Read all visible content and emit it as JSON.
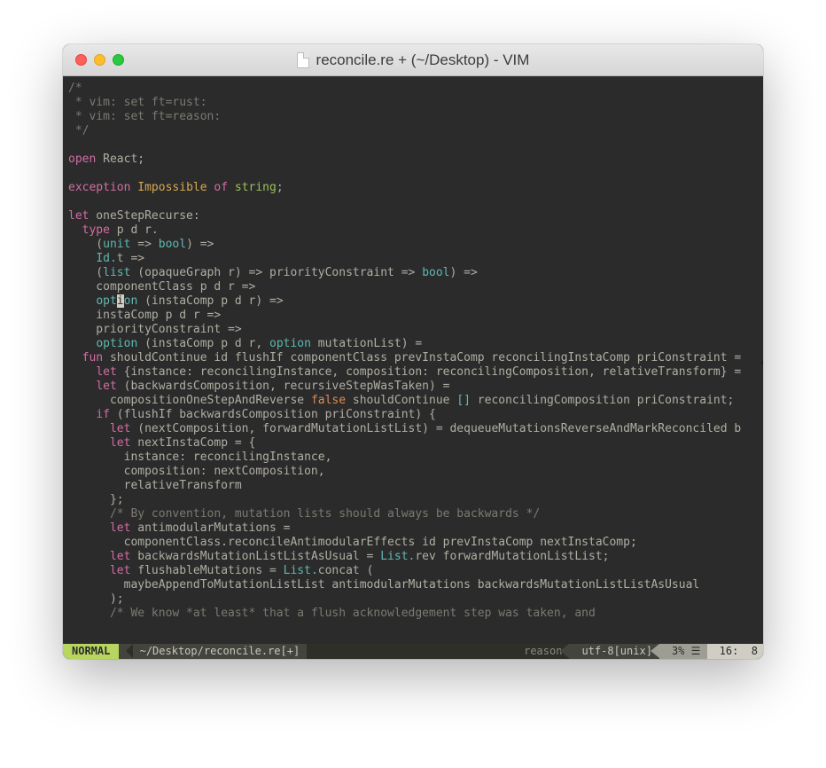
{
  "window": {
    "title": "reconcile.re + (~/Desktop) - VIM"
  },
  "code": {
    "lines": [
      [
        {
          "cls": "c-gray",
          "t": "/*"
        }
      ],
      [
        {
          "cls": "c-gray",
          "t": " * vim: set ft=rust:"
        }
      ],
      [
        {
          "cls": "c-gray",
          "t": " * vim: set ft=reason:"
        }
      ],
      [
        {
          "cls": "c-gray",
          "t": " */"
        }
      ],
      [
        {
          "cls": "",
          "t": ""
        }
      ],
      [
        {
          "cls": "c-mag",
          "t": "open"
        },
        {
          "cls": "",
          "t": " React;"
        }
      ],
      [
        {
          "cls": "",
          "t": ""
        }
      ],
      [
        {
          "cls": "c-mag",
          "t": "exception"
        },
        {
          "cls": "",
          "t": " "
        },
        {
          "cls": "c-gold",
          "t": "Impossible"
        },
        {
          "cls": "",
          "t": " "
        },
        {
          "cls": "c-mag",
          "t": "of"
        },
        {
          "cls": "",
          "t": " "
        },
        {
          "cls": "c-green",
          "t": "string"
        },
        {
          "cls": "",
          "t": ";"
        }
      ],
      [
        {
          "cls": "",
          "t": ""
        }
      ],
      [
        {
          "cls": "c-mag",
          "t": "let"
        },
        {
          "cls": "",
          "t": " oneStepRecurse:"
        }
      ],
      [
        {
          "cls": "",
          "t": "  "
        },
        {
          "cls": "c-mag",
          "t": "type"
        },
        {
          "cls": "",
          "t": " p d r."
        }
      ],
      [
        {
          "cls": "",
          "t": "    ("
        },
        {
          "cls": "c-teal",
          "t": "unit"
        },
        {
          "cls": "",
          "t": " => "
        },
        {
          "cls": "c-teal",
          "t": "bool"
        },
        {
          "cls": "",
          "t": ") =>"
        }
      ],
      [
        {
          "cls": "",
          "t": "    "
        },
        {
          "cls": "c-teal",
          "t": "Id."
        },
        {
          "cls": "",
          "t": "t =>"
        }
      ],
      [
        {
          "cls": "",
          "t": "    ("
        },
        {
          "cls": "c-teal",
          "t": "list"
        },
        {
          "cls": "",
          "t": " (opaqueGraph r) => priorityConstraint => "
        },
        {
          "cls": "c-teal",
          "t": "bool"
        },
        {
          "cls": "",
          "t": ") =>"
        }
      ],
      [
        {
          "cls": "",
          "t": "    componentClass p d r =>"
        }
      ],
      [
        {
          "cls": "",
          "t": "    "
        },
        {
          "cls": "c-teal",
          "t": "opt"
        },
        {
          "cls": "cursor",
          "t": "i"
        },
        {
          "cls": "c-teal",
          "t": "on"
        },
        {
          "cls": "",
          "t": " (instaComp p d r) =>"
        }
      ],
      [
        {
          "cls": "",
          "t": "    instaComp p d r =>"
        }
      ],
      [
        {
          "cls": "",
          "t": "    priorityConstraint =>"
        }
      ],
      [
        {
          "cls": "",
          "t": "    "
        },
        {
          "cls": "c-teal",
          "t": "option"
        },
        {
          "cls": "",
          "t": " (instaComp p d r, "
        },
        {
          "cls": "c-teal",
          "t": "option"
        },
        {
          "cls": "",
          "t": " mutationList) ="
        }
      ],
      [
        {
          "cls": "",
          "t": "  "
        },
        {
          "cls": "c-mag",
          "t": "fun"
        },
        {
          "cls": "",
          "t": " shouldContinue id flushIf componentClass prevInstaComp reconcilingInstaComp priConstraint ="
        }
      ],
      [
        {
          "cls": "",
          "t": "    "
        },
        {
          "cls": "c-mag",
          "t": "let"
        },
        {
          "cls": "",
          "t": " {instance: reconcilingInstance, composition: reconcilingComposition, relativeTransform} ="
        }
      ],
      [
        {
          "cls": "",
          "t": "    "
        },
        {
          "cls": "c-mag",
          "t": "let"
        },
        {
          "cls": "",
          "t": " (backwardsComposition, recursiveStepWasTaken) ="
        }
      ],
      [
        {
          "cls": "",
          "t": "      compositionOneStepAndReverse "
        },
        {
          "cls": "c-orange",
          "t": "false"
        },
        {
          "cls": "",
          "t": " shouldContinue "
        },
        {
          "cls": "c-teal",
          "t": "[]"
        },
        {
          "cls": "",
          "t": " reconcilingComposition priConstraint;"
        }
      ],
      [
        {
          "cls": "",
          "t": "    "
        },
        {
          "cls": "c-mag",
          "t": "if"
        },
        {
          "cls": "",
          "t": " (flushIf backwardsComposition priConstraint) {"
        }
      ],
      [
        {
          "cls": "",
          "t": "      "
        },
        {
          "cls": "c-mag",
          "t": "let"
        },
        {
          "cls": "",
          "t": " (nextComposition, forwardMutationListList) = dequeueMutationsReverseAndMarkReconciled b"
        }
      ],
      [
        {
          "cls": "",
          "t": "      "
        },
        {
          "cls": "c-mag",
          "t": "let"
        },
        {
          "cls": "",
          "t": " nextInstaComp = {"
        }
      ],
      [
        {
          "cls": "",
          "t": "        instance: reconcilingInstance,"
        }
      ],
      [
        {
          "cls": "",
          "t": "        composition: nextComposition,"
        }
      ],
      [
        {
          "cls": "",
          "t": "        relativeTransform"
        }
      ],
      [
        {
          "cls": "",
          "t": "      };"
        }
      ],
      [
        {
          "cls": "",
          "t": "      "
        },
        {
          "cls": "c-gray",
          "t": "/* By convention, mutation lists should always be backwards */"
        }
      ],
      [
        {
          "cls": "",
          "t": "      "
        },
        {
          "cls": "c-mag",
          "t": "let"
        },
        {
          "cls": "",
          "t": " antimodularMutations ="
        }
      ],
      [
        {
          "cls": "",
          "t": "        componentClass.reconcileAntimodularEffects id prevInstaComp nextInstaComp;"
        }
      ],
      [
        {
          "cls": "",
          "t": "      "
        },
        {
          "cls": "c-mag",
          "t": "let"
        },
        {
          "cls": "",
          "t": " backwardsMutationListListAsUsual = "
        },
        {
          "cls": "c-teal",
          "t": "List."
        },
        {
          "cls": "",
          "t": "rev forwardMutationListList;"
        }
      ],
      [
        {
          "cls": "",
          "t": "      "
        },
        {
          "cls": "c-mag",
          "t": "let"
        },
        {
          "cls": "",
          "t": " flushableMutations = "
        },
        {
          "cls": "c-teal",
          "t": "List."
        },
        {
          "cls": "",
          "t": "concat ("
        }
      ],
      [
        {
          "cls": "",
          "t": "        maybeAppendToMutationListList antimodularMutations backwardsMutationListListAsUsual"
        }
      ],
      [
        {
          "cls": "",
          "t": "      );"
        }
      ],
      [
        {
          "cls": "",
          "t": "      "
        },
        {
          "cls": "c-gray",
          "t": "/* We know *at least* that a flush acknowledgement step was taken, and"
        }
      ]
    ]
  },
  "status": {
    "mode": "NORMAL",
    "path": "~/Desktop/reconcile.re[+]",
    "filetype": "reason",
    "encoding": "utf-8[unix]",
    "percent": "3%",
    "scroll_glyph": "☰",
    "line": "16",
    "col": "8"
  }
}
